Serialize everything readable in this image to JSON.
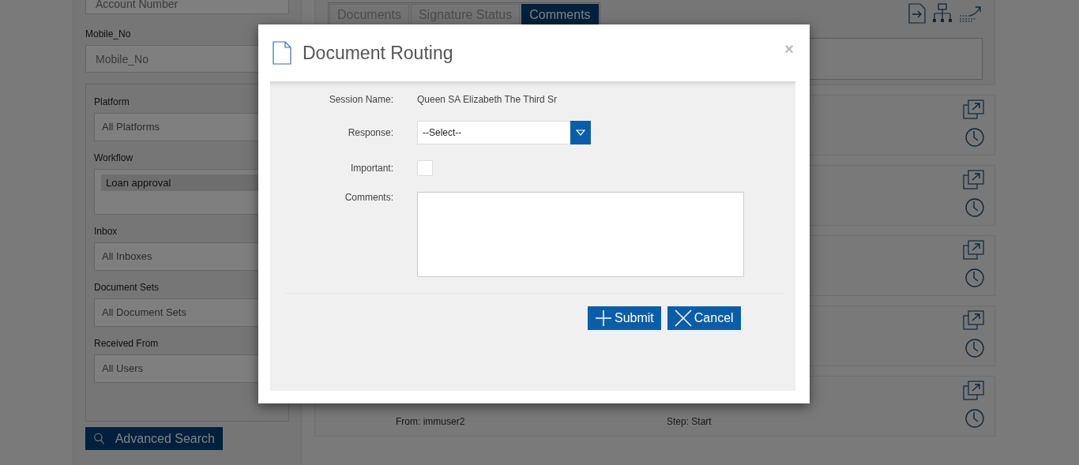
{
  "search_panel": {
    "account_number": {
      "placeholder": "Account Number"
    },
    "mobile_no": {
      "label": "Mobile_No",
      "placeholder": "Mobile_No"
    },
    "filters": [
      {
        "kind": "select",
        "label": "Platform",
        "value": "All Platforms"
      },
      {
        "kind": "list",
        "label": "Workflow",
        "items": [
          {
            "label": "Loan approval",
            "selected": true
          }
        ]
      },
      {
        "kind": "select",
        "label": "Inbox",
        "value": "All Inboxes"
      },
      {
        "kind": "select",
        "label": "Document Sets",
        "value": "All Document Sets"
      },
      {
        "kind": "select",
        "label": "Received From",
        "value": "All Users"
      }
    ],
    "advanced_search": "Advanced Search"
  },
  "tabs": [
    {
      "label": "Documents",
      "selected": false
    },
    {
      "label": "Signature Status",
      "selected": false
    },
    {
      "label": "Comments",
      "selected": true
    }
  ],
  "last_card": {
    "from": "From: immuser2",
    "step": "Step: Start"
  },
  "dialog": {
    "title": "Document Routing",
    "close": "×",
    "session_label": "Session Name:",
    "session_value": "Queen SA Elizabeth The Third Sr",
    "response": {
      "label": "Response:",
      "value": "--Select--"
    },
    "important": {
      "label": "Important:",
      "checked": false
    },
    "comments": {
      "label": "Comments:"
    },
    "buttons": [
      {
        "kind": "submit",
        "label": "Submit"
      },
      {
        "kind": "cancel",
        "label": "Cancel"
      }
    ]
  }
}
